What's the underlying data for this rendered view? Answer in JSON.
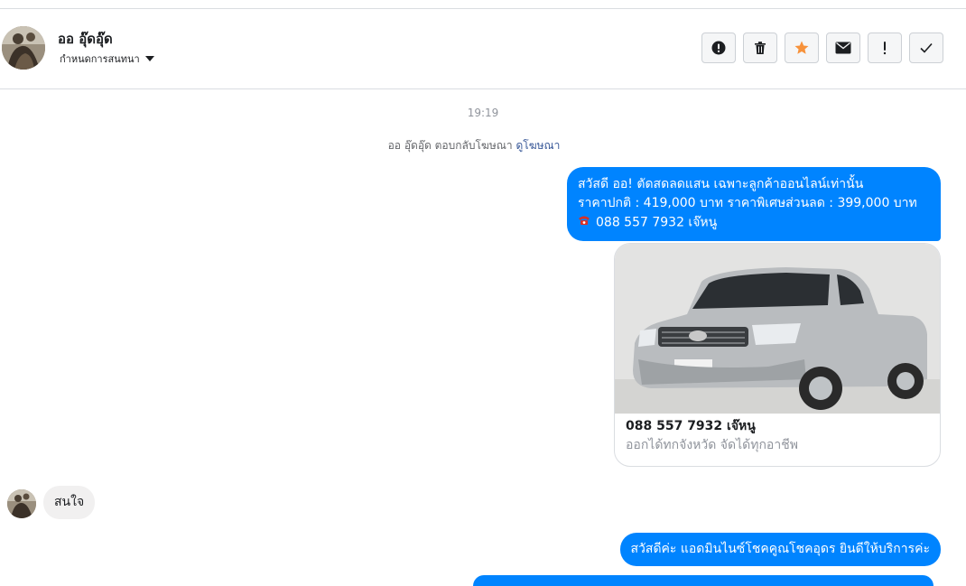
{
  "header": {
    "name": "ออ อุ๊ดอุ๊ด",
    "subtitle": "กำหนดการสนทนา",
    "actions": [
      {
        "id": "alert",
        "icon": "exclamation-circle-icon"
      },
      {
        "id": "delete",
        "icon": "trash-icon"
      },
      {
        "id": "star",
        "icon": "star-icon",
        "color": "#f7923b"
      },
      {
        "id": "mail",
        "icon": "envelope-icon"
      },
      {
        "id": "important",
        "icon": "exclamation-icon"
      },
      {
        "id": "done",
        "icon": "checkmark-icon"
      }
    ]
  },
  "thread": {
    "time": "19:19",
    "system_text": "ออ อุ๊ดอุ๊ด ตอบกลับโฆษณา",
    "system_link": "ดูโฆษณา",
    "msg1": {
      "line1": "สวัสดี ออ! ตัดสดลดแสน เฉพาะลูกค้าออนไลน์เท่านั้น",
      "line2": "ราคาปกติ : 419,000 บาท  ราคาพิเศษส่วนลด : 399,000 บาท",
      "line3": "088 557 7932 เจ๊หนู"
    },
    "card": {
      "title": "088 557 7932 เจ๊หนู",
      "subtitle": "ออกได้ทกจังหวัด จัดได้ทุกอาชีพ"
    },
    "incoming": "สนใจ",
    "msg2": "สวัสดีค่ะ แอดมินไนซ์โชคคูณโชคอุดร ยินดีให้บริการค่ะ"
  },
  "colors": {
    "outgoing_bubble": "#0084ff",
    "incoming_bubble": "#f1f0f0",
    "star": "#f7923b",
    "link": "#385898"
  }
}
